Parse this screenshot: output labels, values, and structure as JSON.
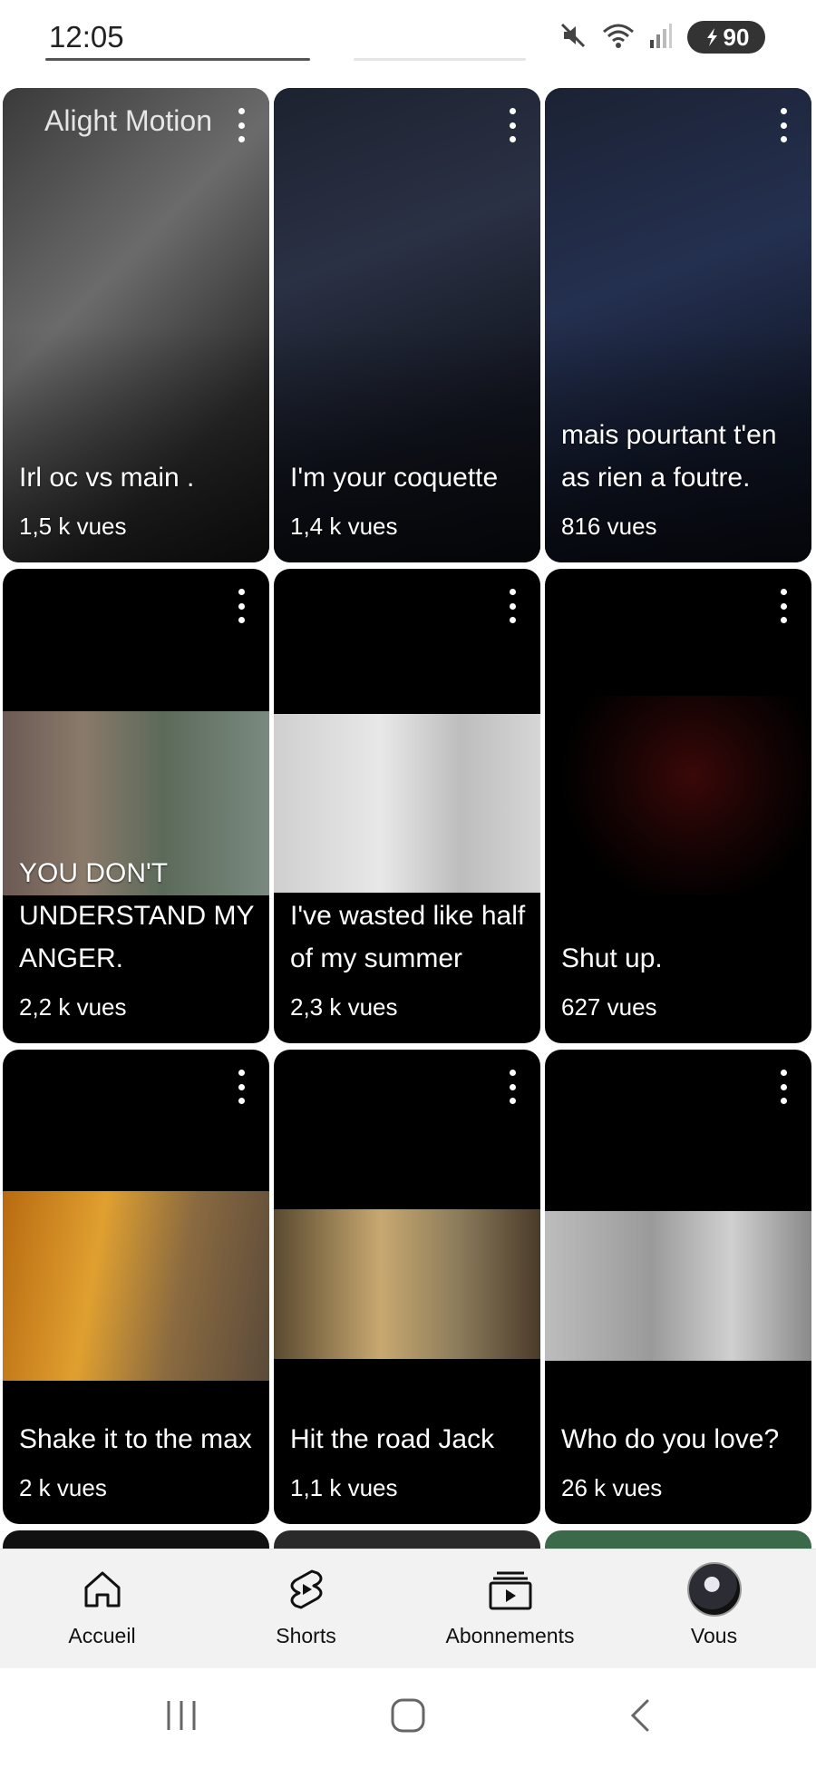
{
  "status_bar": {
    "time": "12:05",
    "battery": "90",
    "icons": [
      "mute-icon",
      "wifi-icon",
      "signal-icon",
      "battery-icon"
    ]
  },
  "videos": [
    {
      "title": "Irl oc vs main .",
      "views": "1,5 k vues",
      "watermark": "Alight Motion"
    },
    {
      "title": "I'm your coquette",
      "views": "1,4 k vues"
    },
    {
      "title": "mais pourtant t'en as rien a foutre.",
      "views": "816 vues"
    },
    {
      "title": "YOU DON'T UNDERSTAND MY ANGER.",
      "views": "2,2 k vues"
    },
    {
      "title": "I've wasted like half of my summer",
      "views": "2,3 k vues"
    },
    {
      "title": "Shut up.",
      "views": "627 vues"
    },
    {
      "title": "Shake it to the max",
      "views": "2 k vues"
    },
    {
      "title": "Hit the road Jack",
      "views": "1,1 k vues"
    },
    {
      "title": "Who do you love?",
      "views": "26 k vues"
    }
  ],
  "bottom_nav": [
    {
      "label": "Accueil",
      "icon": "home-icon"
    },
    {
      "label": "Shorts",
      "icon": "shorts-icon"
    },
    {
      "label": "Abonnements",
      "icon": "subscriptions-icon"
    },
    {
      "label": "Vous",
      "icon": "avatar"
    }
  ],
  "system_nav": [
    "recents-icon",
    "home-button-icon",
    "back-icon"
  ]
}
